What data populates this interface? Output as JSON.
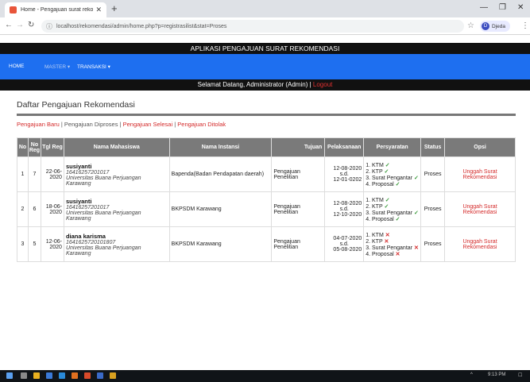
{
  "browser": {
    "tab_title": "Home - Pengajuan surat rekome",
    "url": "localhost/rekomendasi/admin/home.php?p=registrasilist&stat=Proses",
    "profile_name": "Djeda",
    "profile_initial": "D"
  },
  "app": {
    "title": "APLIKASI PENGAJUAN SURAT REKOMENDASI",
    "nav": [
      {
        "label": "HOME"
      },
      {
        "label": "MASTER"
      },
      {
        "label": "TRANSAKSI"
      }
    ],
    "welcome_text": "Selamat Datang, Administrator (Admin) | ",
    "logout_label": "Logout"
  },
  "page": {
    "heading": "Daftar Pengajuan Rekomendasi",
    "filters": {
      "baru": "Pengajuan Baru",
      "sep1": " | ",
      "diproses": "Pengajuan Diproses",
      "sep2": " | ",
      "selesai": "Pengajuan Selesai",
      "sep3": " | ",
      "ditolak": "Pengajuan Ditolak"
    }
  },
  "table": {
    "headers": {
      "no": "No",
      "no_reg": "No Reg",
      "tgl_reg": "Tgl Reg",
      "nama": "Nama Mahasiswa",
      "instansi": "Nama Instansi",
      "tujuan": "Tujuan",
      "pelaksanaan": "Pelaksanaan",
      "persyaratan": "Persyaratan",
      "status": "Status",
      "opsi": "Opsi"
    },
    "rows": [
      {
        "no": "1",
        "no_reg": "7",
        "tgl_reg": "22-06-2020",
        "nama": "susiyanti",
        "nim": "16416257201017",
        "univ": "Universitas Buana Perjuangan Karawang",
        "instansi": "Bapenda(Badan Pendapatan daerah)",
        "tujuan": "Pengajuan Penelitian",
        "mulai": "12-08-2020",
        "sd": "s.d.",
        "selesai": "12-01-0202",
        "req1": "1. KTM",
        "req2": "2. KTP",
        "req3": "3. Surat Pengantar",
        "req4": "4. Proposal",
        "status": "Proses",
        "opsi": "Unggah Surat Rekomendasi"
      },
      {
        "no": "2",
        "no_reg": "6",
        "tgl_reg": "18-06-2020",
        "nama": "susiyanti",
        "nim": "16416257201017",
        "univ": "Universitas Buana Perjuangan Karawang",
        "instansi": "BKPSDM Karawang",
        "tujuan": "Pengajuan Penelitian",
        "mulai": "12-08-2020",
        "sd": "s.d.",
        "selesai": "12-10-2020",
        "req1": "1. KTM",
        "req2": "2. KTP",
        "req3": "3. Surat Pengantar",
        "req4": "4. Proposal",
        "status": "Proses",
        "opsi": "Unggah Surat Rekomendasi"
      },
      {
        "no": "3",
        "no_reg": "5",
        "tgl_reg": "12-06-2020",
        "nama": "diana karisma",
        "nim": "16416257201018​07",
        "univ": "Universitas Buana Perjuangan Karawang",
        "instansi": "BKPSDM Karawang",
        "tujuan": "Pengajuan Penelitian",
        "mulai": "04-07-2020",
        "sd": "s.d.",
        "selesai": "05-08-2020",
        "req1": "1. KTM",
        "req2": "2. KTP",
        "req3": "3. Surat Pengantar",
        "req4": "4. Proposal",
        "status": "Proses",
        "opsi": "Unggah Surat Rekomendasi"
      }
    ]
  },
  "taskbar": {
    "clock": "9:13 PM"
  },
  "colors": {
    "navbar": "#1e6ff0",
    "accent_red": "#d42a2a",
    "check_green": "#3a9a3a"
  }
}
